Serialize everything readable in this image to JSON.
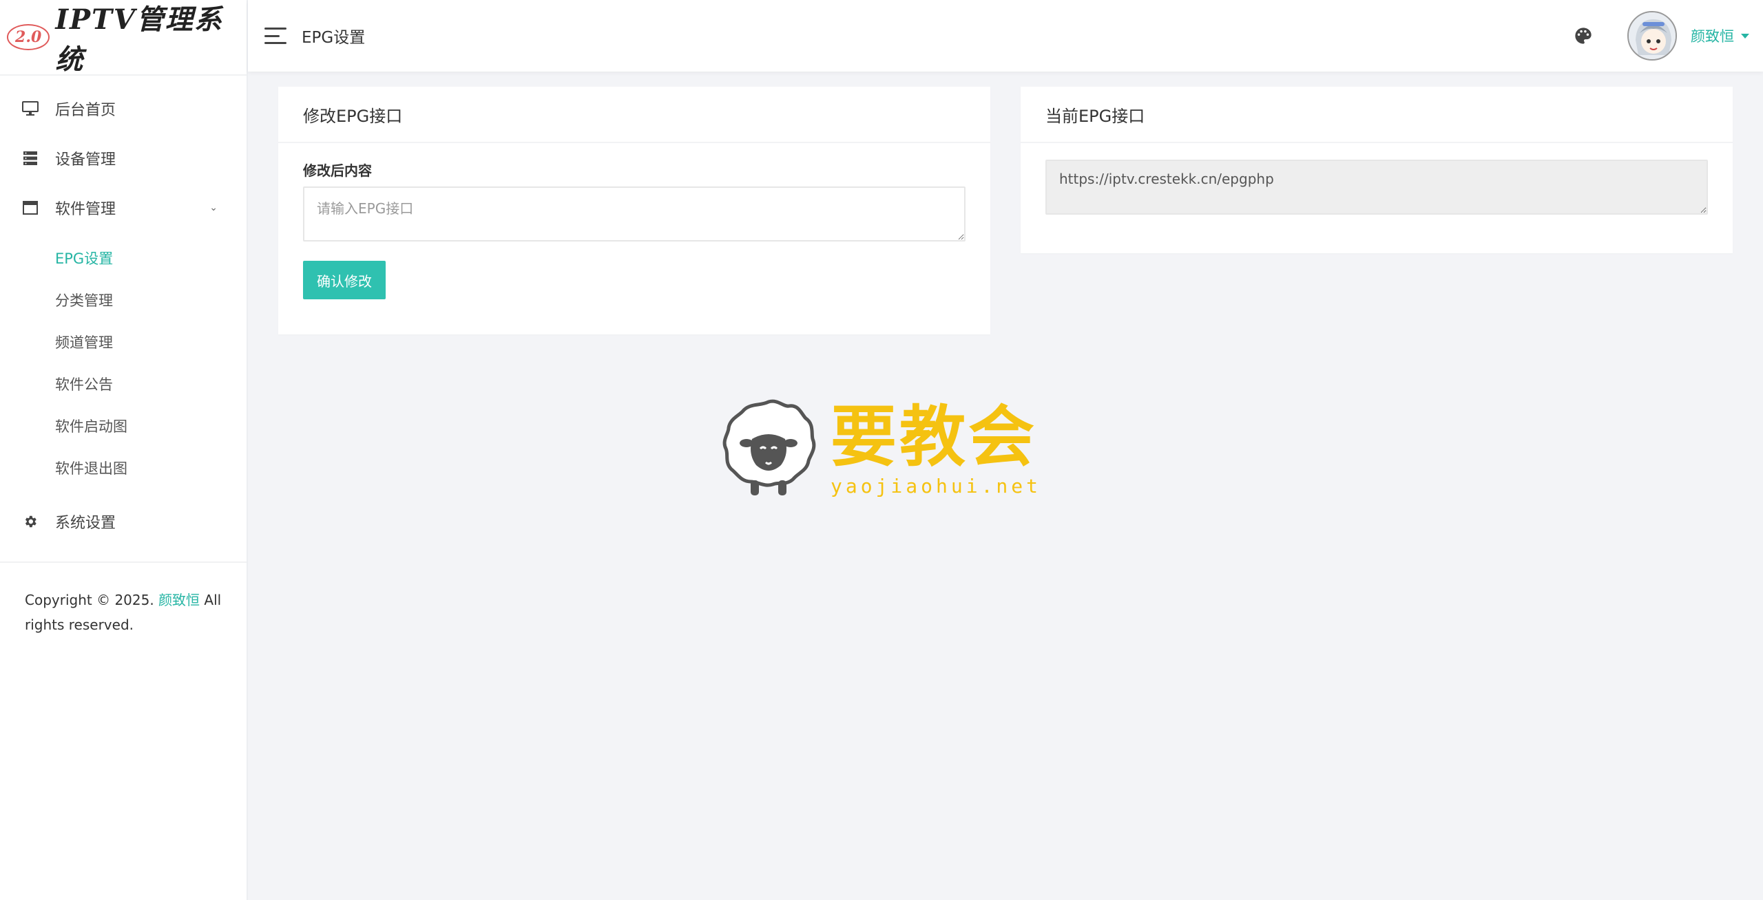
{
  "logo": {
    "badge": "2.0",
    "title": "IPTV管理系统"
  },
  "sidebar": {
    "items": [
      {
        "label": "后台首页",
        "icon": "monitor-icon"
      },
      {
        "label": "设备管理",
        "icon": "server-icon"
      },
      {
        "label": "软件管理",
        "icon": "window-icon"
      },
      {
        "label": "系统设置",
        "icon": "gear-icon"
      }
    ],
    "submenu": [
      {
        "label": "EPG设置",
        "active": true
      },
      {
        "label": "分类管理"
      },
      {
        "label": "频道管理"
      },
      {
        "label": "软件公告"
      },
      {
        "label": "软件启动图"
      },
      {
        "label": "软件退出图"
      }
    ],
    "copyright": {
      "prefix": "Copyright © 2025.",
      "author": "颜致恒",
      "suffix": "All rights reserved."
    }
  },
  "header": {
    "title": "EPG设置",
    "user": "颜致恒"
  },
  "edit_card": {
    "title": "修改EPG接口",
    "field_label": "修改后内容",
    "placeholder": "请输入EPG接口",
    "value": "",
    "button": "确认修改"
  },
  "current_card": {
    "title": "当前EPG接口",
    "value": "https://iptv.crestekk.cn/epgphp"
  },
  "watermark": {
    "cn": "要教会",
    "en": "yaojiaohui.net"
  },
  "colors": {
    "accent": "#26b5a4",
    "button": "#2fc1b0",
    "watermark": "#f5c211"
  }
}
